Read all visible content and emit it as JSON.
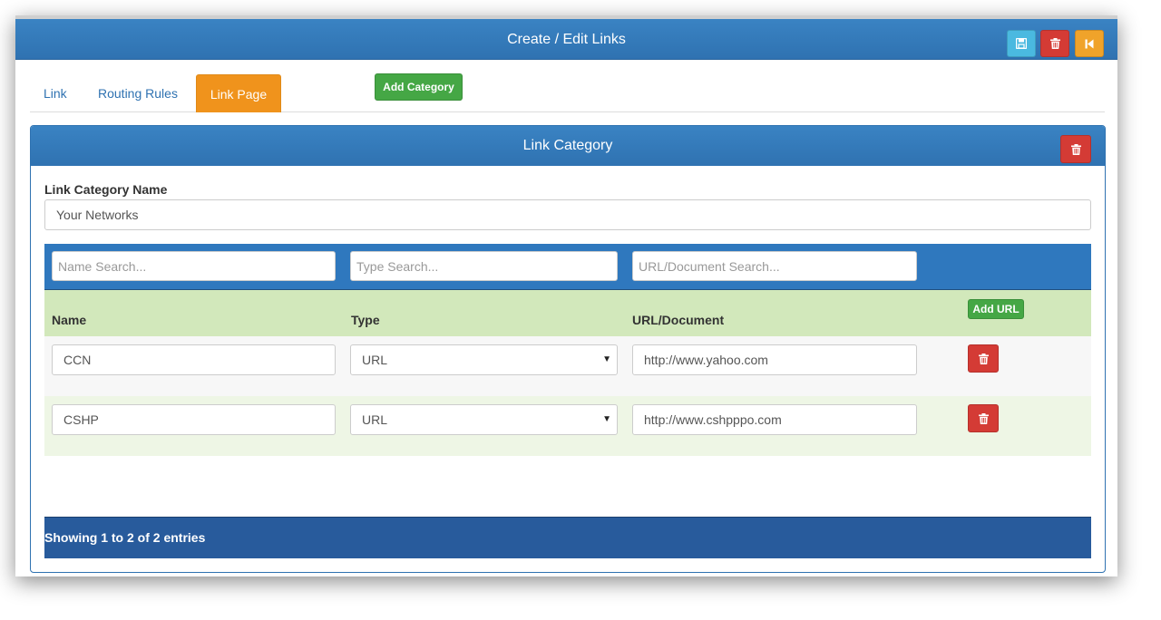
{
  "window": {
    "title": "Create / Edit Links",
    "actions": [
      {
        "name": "save",
        "icon": "floppy-disk-icon",
        "color": "#4ab9e0"
      },
      {
        "name": "delete",
        "icon": "trash-icon",
        "color": "#d43b35"
      },
      {
        "name": "back",
        "icon": "skip-back-icon",
        "color": "#f0a32a"
      }
    ]
  },
  "tabs": [
    {
      "label": "Link",
      "active": false
    },
    {
      "label": "Routing Rules",
      "active": false
    },
    {
      "label": "Link Page",
      "active": true
    }
  ],
  "add_category_label": "Add Category",
  "panel": {
    "title": "Link Category",
    "category_name_label": "Link Category Name",
    "category_name_value": "Your Networks"
  },
  "table": {
    "search": {
      "name_placeholder": "Name Search...",
      "type_placeholder": "Type Search...",
      "url_placeholder": "URL/Document Search..."
    },
    "columns": [
      "Name",
      "Type",
      "URL/Document"
    ],
    "add_url_label": "Add URL",
    "rows": [
      {
        "name": "CCN",
        "type": "URL",
        "url": "http://www.yahoo.com"
      },
      {
        "name": "CSHP",
        "type": "URL",
        "url": "http://www.cshpppo.com"
      }
    ],
    "footer": "Showing 1 to 2 of 2 entries"
  },
  "colors": {
    "header_blue": "#2f72b1",
    "active_tab": "#f0931c",
    "green": "#45a745",
    "danger": "#d43b35",
    "table_header": "#d2e8bb",
    "footer": "#285b9c"
  }
}
